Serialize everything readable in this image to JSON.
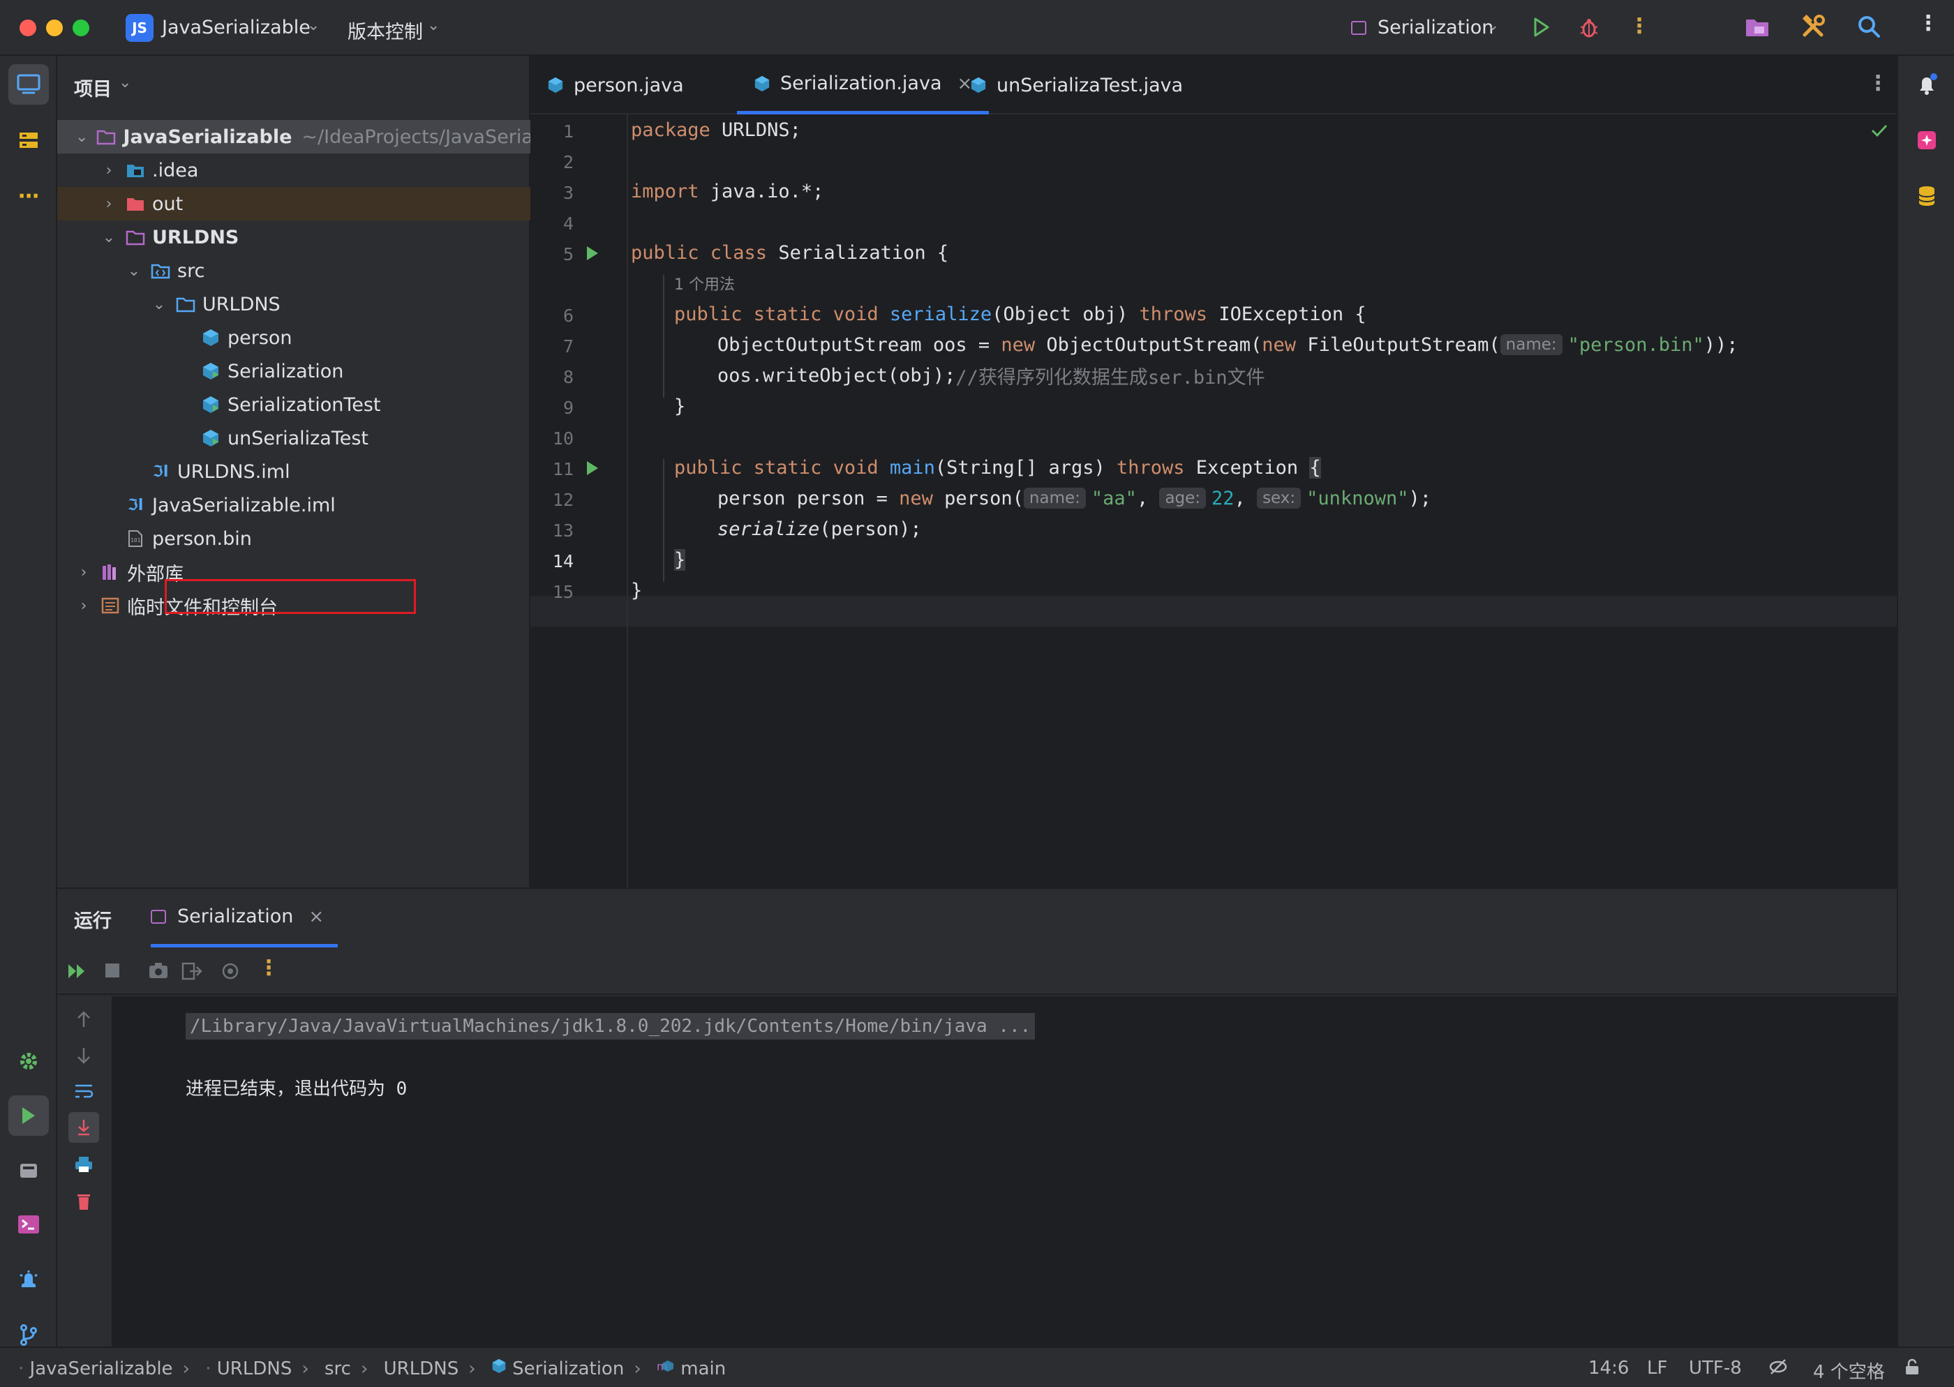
{
  "titlebar": {
    "project_badge": "JS",
    "project_name": "JavaSerializable",
    "vcs_label": "版本控制",
    "run_config": "Serialization"
  },
  "project_panel": {
    "header": "项目",
    "tree": [
      {
        "label": "JavaSerializable",
        "path": "~/IdeaProjects/JavaSerializab",
        "depth": 0,
        "expanded": true,
        "icon": "folder-icon",
        "bold": true
      },
      {
        "label": ".idea",
        "depth": 1,
        "expanded": false,
        "icon": "idea-folder-icon"
      },
      {
        "label": "out",
        "depth": 1,
        "expanded": false,
        "icon": "excluded-folder-icon"
      },
      {
        "label": "URLDNS",
        "depth": 1,
        "expanded": true,
        "icon": "module-folder-icon",
        "bold": true
      },
      {
        "label": "src",
        "depth": 2,
        "expanded": true,
        "icon": "source-folder-icon"
      },
      {
        "label": "URLDNS",
        "depth": 3,
        "expanded": true,
        "icon": "package-icon"
      },
      {
        "label": "person",
        "depth": 4,
        "icon": "class-icon"
      },
      {
        "label": "Serialization",
        "depth": 4,
        "icon": "runnable-class-icon"
      },
      {
        "label": "SerializationTest",
        "depth": 4,
        "icon": "runnable-class-icon"
      },
      {
        "label": "unSerializaTest",
        "depth": 4,
        "icon": "runnable-class-icon"
      },
      {
        "label": "URLDNS.iml",
        "depth": 3,
        "icon": "iml-icon"
      },
      {
        "label": "JavaSerializable.iml",
        "depth": 2,
        "icon": "iml-icon"
      },
      {
        "label": "person.bin",
        "depth": 2,
        "icon": "binary-file-icon"
      },
      {
        "label": "外部库",
        "depth": 0,
        "expanded": false,
        "icon": "library-icon"
      },
      {
        "label": "临时文件和控制台",
        "depth": 0,
        "expanded": false,
        "icon": "scratches-icon"
      }
    ]
  },
  "editor": {
    "tabs": [
      {
        "label": "person.java",
        "active": false
      },
      {
        "label": "Serialization.java",
        "active": true,
        "closable": true
      },
      {
        "label": "unSerializaTest.java",
        "active": false
      }
    ],
    "line_numbers": [
      "1",
      "2",
      "3",
      "4",
      "5",
      "6",
      "7",
      "8",
      "9",
      "10",
      "11",
      "12",
      "13",
      "14",
      "15"
    ],
    "usage_hint": "1 个用法",
    "code": {
      "l1_kw": "package",
      "l1_rest": " URLDNS;",
      "l3_kw": "import",
      "l3_rest": " java.io.*;",
      "l5_kw": "public class",
      "l5_rest": " Serialization {",
      "l6_kw1": "public static void",
      "l6_fn": "serialize",
      "l6_mid": "(Object obj) ",
      "l6_kw2": "throws",
      "l6_rest": " IOException {",
      "l7_a": "ObjectOutputStream oos = ",
      "l7_kw1": "new",
      "l7_b": " ObjectOutputStream(",
      "l7_kw2": "new",
      "l7_c": " FileOutputStream(",
      "l7_hint": "name:",
      "l7_str": "\"person.bin\"",
      "l7_end": "));",
      "l8_a": "oos.writeObject(obj);",
      "l8_cmt": "//获得序列化数据生成ser.bin文件",
      "l9": "}",
      "l11_kw1": "public static void",
      "l11_fn": "main",
      "l11_mid": "(String[] args) ",
      "l11_kw2": "throws",
      "l11_rest": " Exception ",
      "l11_brace": "{",
      "l12_a": "person person = ",
      "l12_kw": "new",
      "l12_b": " person(",
      "l12_h1": "name:",
      "l12_s1": "\"aa\"",
      "l12_c1": ", ",
      "l12_h2": "age:",
      "l12_n": "22",
      "l12_c2": ", ",
      "l12_h3": "sex:",
      "l12_s2": "\"unknown\"",
      "l12_end": ");",
      "l13_fn": "serialize",
      "l13_rest": "(person);",
      "l14": "}",
      "l15": "}"
    }
  },
  "run_panel": {
    "title": "运行",
    "tab_label": "Serialization",
    "command": "/Library/Java/JavaVirtualMachines/jdk1.8.0_202.jdk/Contents/Home/bin/java ...",
    "exit_message": "进程已结束，退出代码为 0"
  },
  "statusbar": {
    "breadcrumbs": [
      "JavaSerializable",
      "URLDNS",
      "src",
      "URLDNS",
      "Serialization",
      "main"
    ],
    "position": "14:6",
    "line_sep": "LF",
    "encoding": "UTF-8",
    "indent": "4 个空格"
  },
  "colors": {
    "accent": "#3574f0",
    "keyword": "#cf8e6d",
    "function": "#56a8f5",
    "string": "#6aab73",
    "number": "#2aacb8",
    "highlight_box": "#e01b24"
  }
}
